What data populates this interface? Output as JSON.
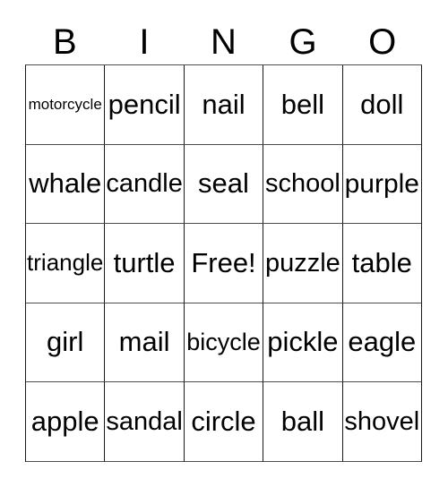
{
  "card": {
    "title": "BINGO",
    "header_letters": [
      "B",
      "I",
      "N",
      "G",
      "O"
    ],
    "free_space_label": "Free!",
    "grid_size": "5x5",
    "colors": {
      "text": "#000000",
      "grid_line": "#1a1a1a",
      "grid_line_light": "#4d4d4d",
      "background": "#ffffff"
    },
    "rows": [
      {
        "index": 1,
        "cells": [
          {
            "column": "B",
            "word": "motorcycle"
          },
          {
            "column": "I",
            "word": "pencil"
          },
          {
            "column": "N",
            "word": "nail"
          },
          {
            "column": "G",
            "word": "bell"
          },
          {
            "column": "O",
            "word": "doll"
          }
        ]
      },
      {
        "index": 2,
        "cells": [
          {
            "column": "B",
            "word": "whale"
          },
          {
            "column": "I",
            "word": "candle"
          },
          {
            "column": "N",
            "word": "seal"
          },
          {
            "column": "G",
            "word": "school"
          },
          {
            "column": "O",
            "word": "purple"
          }
        ]
      },
      {
        "index": 3,
        "cells": [
          {
            "column": "B",
            "word": "triangle"
          },
          {
            "column": "I",
            "word": "turtle"
          },
          {
            "column": "N",
            "word": "Free!"
          },
          {
            "column": "G",
            "word": "puzzle"
          },
          {
            "column": "O",
            "word": "table"
          }
        ]
      },
      {
        "index": 4,
        "cells": [
          {
            "column": "B",
            "word": "girl"
          },
          {
            "column": "I",
            "word": "mail"
          },
          {
            "column": "N",
            "word": "bicycle"
          },
          {
            "column": "G",
            "word": "pickle"
          },
          {
            "column": "O",
            "word": "eagle"
          }
        ]
      },
      {
        "index": 5,
        "cells": [
          {
            "column": "B",
            "word": "apple"
          },
          {
            "column": "I",
            "word": "sandal"
          },
          {
            "column": "N",
            "word": "circle"
          },
          {
            "column": "G",
            "word": "ball"
          },
          {
            "column": "O",
            "word": "shovel"
          }
        ]
      }
    ]
  }
}
